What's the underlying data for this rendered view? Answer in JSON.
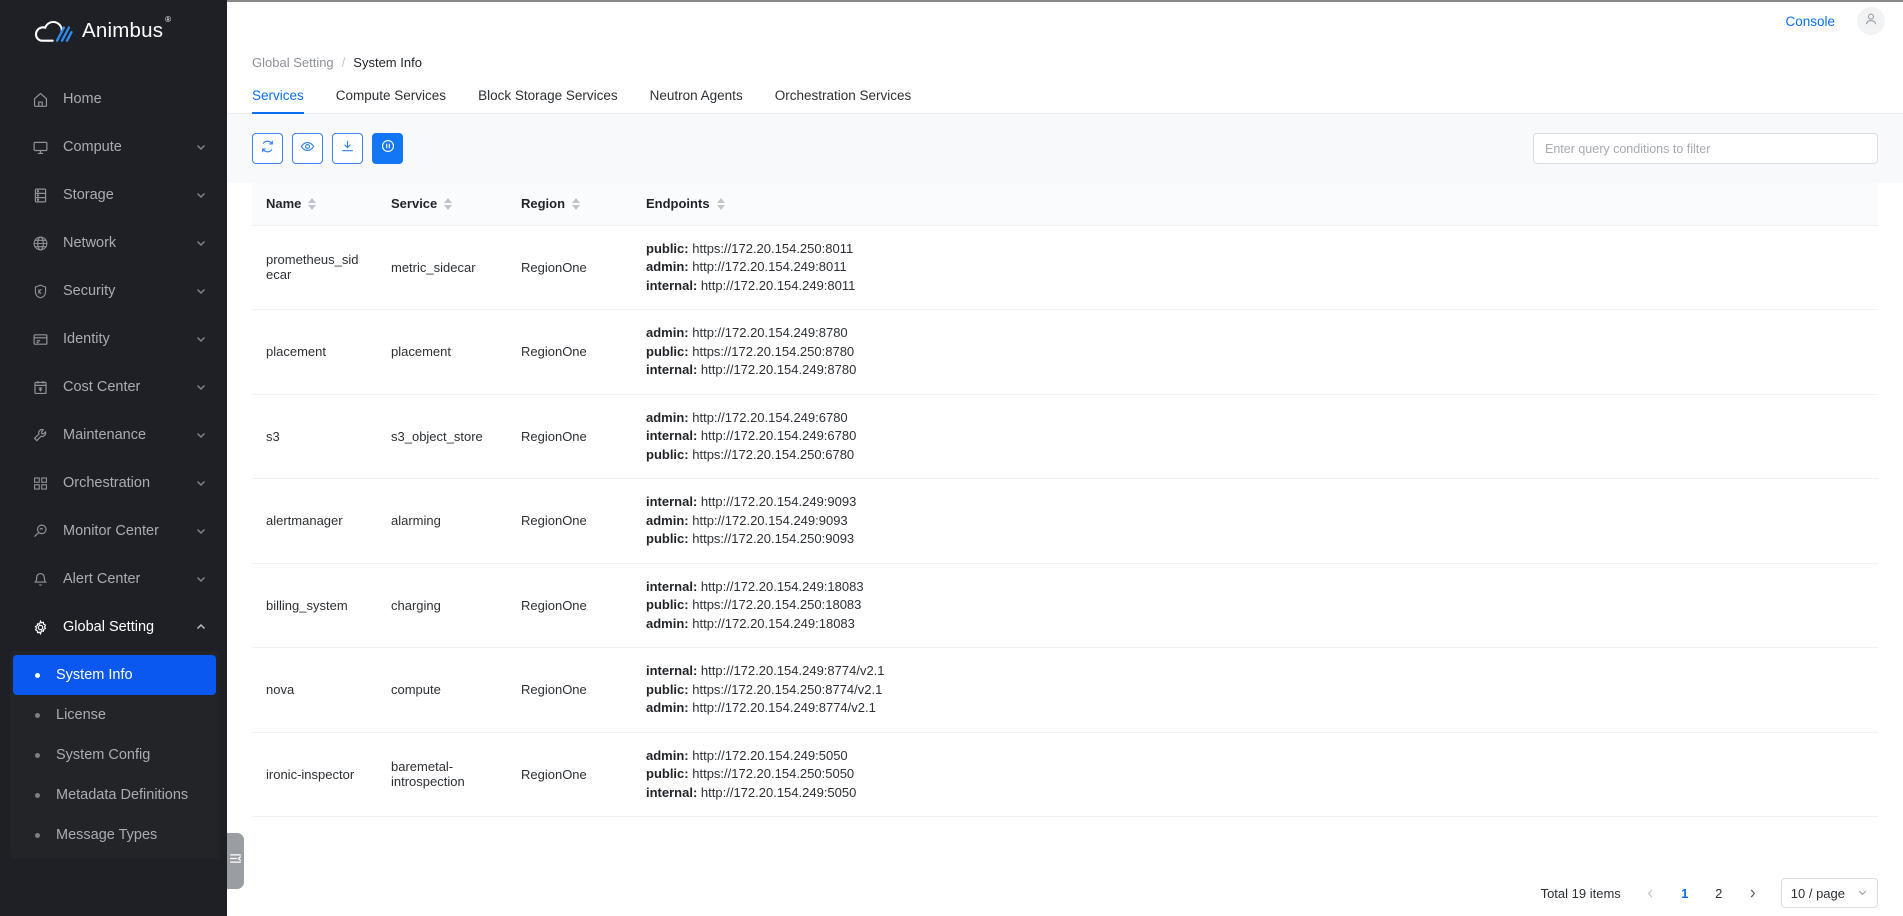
{
  "brand": {
    "name": "Animbus",
    "registered": "®",
    "logo_icon": "cloud-logo-icon",
    "accent": "#0a6ef5",
    "sidebar_bg": "#1e2025",
    "active_bg": "#0a58f0"
  },
  "topbar": {
    "console_label": "Console",
    "avatar_icon": "user-avatar-icon"
  },
  "breadcrumb": {
    "parent": "Global Setting",
    "separator": "/",
    "current": "System Info"
  },
  "sidebar": {
    "items": [
      {
        "label": "Home",
        "icon": "home-icon",
        "expandable": false
      },
      {
        "label": "Compute",
        "icon": "monitor-icon",
        "expandable": true
      },
      {
        "label": "Storage",
        "icon": "database-icon",
        "expandable": true
      },
      {
        "label": "Network",
        "icon": "globe-icon",
        "expandable": true
      },
      {
        "label": "Security",
        "icon": "shield-icon",
        "expandable": true
      },
      {
        "label": "Identity",
        "icon": "id-card-icon",
        "expandable": true
      },
      {
        "label": "Cost Center",
        "icon": "calendar-cost-icon",
        "expandable": true
      },
      {
        "label": "Maintenance",
        "icon": "wrench-icon",
        "expandable": true
      },
      {
        "label": "Orchestration",
        "icon": "grid-blocks-icon",
        "expandable": true
      },
      {
        "label": "Monitor Center",
        "icon": "magnifier-pulse-icon",
        "expandable": true
      },
      {
        "label": "Alert Center",
        "icon": "bell-icon",
        "expandable": true
      },
      {
        "label": "Global Setting",
        "icon": "gear-icon",
        "expandable": true,
        "expanded": true
      }
    ],
    "submenu": [
      {
        "label": "System Info",
        "active": true
      },
      {
        "label": "License",
        "active": false
      },
      {
        "label": "System Config",
        "active": false
      },
      {
        "label": "Metadata Definitions",
        "active": false
      },
      {
        "label": "Message Types",
        "active": false
      }
    ],
    "collapse_handle_icon": "collapse-menu-icon"
  },
  "tabs": [
    {
      "label": "Services",
      "active": true
    },
    {
      "label": "Compute Services",
      "active": false
    },
    {
      "label": "Block Storage Services",
      "active": false
    },
    {
      "label": "Neutron Agents",
      "active": false
    },
    {
      "label": "Orchestration Services",
      "active": false
    }
  ],
  "toolbar": {
    "buttons": [
      {
        "icon": "refresh-icon",
        "style": "outline"
      },
      {
        "icon": "eye-icon",
        "style": "outline"
      },
      {
        "icon": "download-icon",
        "style": "outline"
      },
      {
        "icon": "pause-circle-icon",
        "style": "filled"
      }
    ],
    "filter": {
      "placeholder": "Enter query conditions to filter",
      "value": ""
    }
  },
  "table": {
    "columns": [
      {
        "label": "Name",
        "sortable": true
      },
      {
        "label": "Service",
        "sortable": true
      },
      {
        "label": "Region",
        "sortable": true
      },
      {
        "label": "Endpoints",
        "sortable": true
      }
    ],
    "rows": [
      {
        "name": "prometheus_sidecar",
        "service": "metric_sidecar",
        "region": "RegionOne",
        "endpoints": [
          {
            "type": "public:",
            "url": "https://172.20.154.250:8011"
          },
          {
            "type": "admin:",
            "url": "http://172.20.154.249:8011"
          },
          {
            "type": "internal:",
            "url": "http://172.20.154.249:8011"
          }
        ]
      },
      {
        "name": "placement",
        "service": "placement",
        "region": "RegionOne",
        "endpoints": [
          {
            "type": "admin:",
            "url": "http://172.20.154.249:8780"
          },
          {
            "type": "public:",
            "url": "https://172.20.154.250:8780"
          },
          {
            "type": "internal:",
            "url": "http://172.20.154.249:8780"
          }
        ]
      },
      {
        "name": "s3",
        "service": "s3_object_store",
        "region": "RegionOne",
        "endpoints": [
          {
            "type": "admin:",
            "url": "http://172.20.154.249:6780"
          },
          {
            "type": "internal:",
            "url": "http://172.20.154.249:6780"
          },
          {
            "type": "public:",
            "url": "https://172.20.154.250:6780"
          }
        ]
      },
      {
        "name": "alertmanager",
        "service": "alarming",
        "region": "RegionOne",
        "endpoints": [
          {
            "type": "internal:",
            "url": "http://172.20.154.249:9093"
          },
          {
            "type": "admin:",
            "url": "http://172.20.154.249:9093"
          },
          {
            "type": "public:",
            "url": "https://172.20.154.250:9093"
          }
        ]
      },
      {
        "name": "billing_system",
        "service": "charging",
        "region": "RegionOne",
        "endpoints": [
          {
            "type": "internal:",
            "url": "http://172.20.154.249:18083"
          },
          {
            "type": "public:",
            "url": "https://172.20.154.250:18083"
          },
          {
            "type": "admin:",
            "url": "http://172.20.154.249:18083"
          }
        ]
      },
      {
        "name": "nova",
        "service": "compute",
        "region": "RegionOne",
        "endpoints": [
          {
            "type": "internal:",
            "url": "http://172.20.154.249:8774/v2.1"
          },
          {
            "type": "public:",
            "url": "https://172.20.154.250:8774/v2.1"
          },
          {
            "type": "admin:",
            "url": "http://172.20.154.249:8774/v2.1"
          }
        ]
      },
      {
        "name": "ironic-inspector",
        "service": "baremetal-introspection",
        "region": "RegionOne",
        "endpoints": [
          {
            "type": "admin:",
            "url": "http://172.20.154.249:5050"
          },
          {
            "type": "public:",
            "url": "https://172.20.154.250:5050"
          },
          {
            "type": "internal:",
            "url": "http://172.20.154.249:5050"
          }
        ]
      }
    ]
  },
  "pagination": {
    "total_label": "Total 19 items",
    "prev_icon": "chevron-left-icon",
    "next_icon": "chevron-right-icon",
    "pages": [
      {
        "label": "1",
        "active": true
      },
      {
        "label": "2",
        "active": false
      }
    ],
    "page_size_label": "10 / page",
    "page_size_icon": "chevron-down-icon"
  }
}
